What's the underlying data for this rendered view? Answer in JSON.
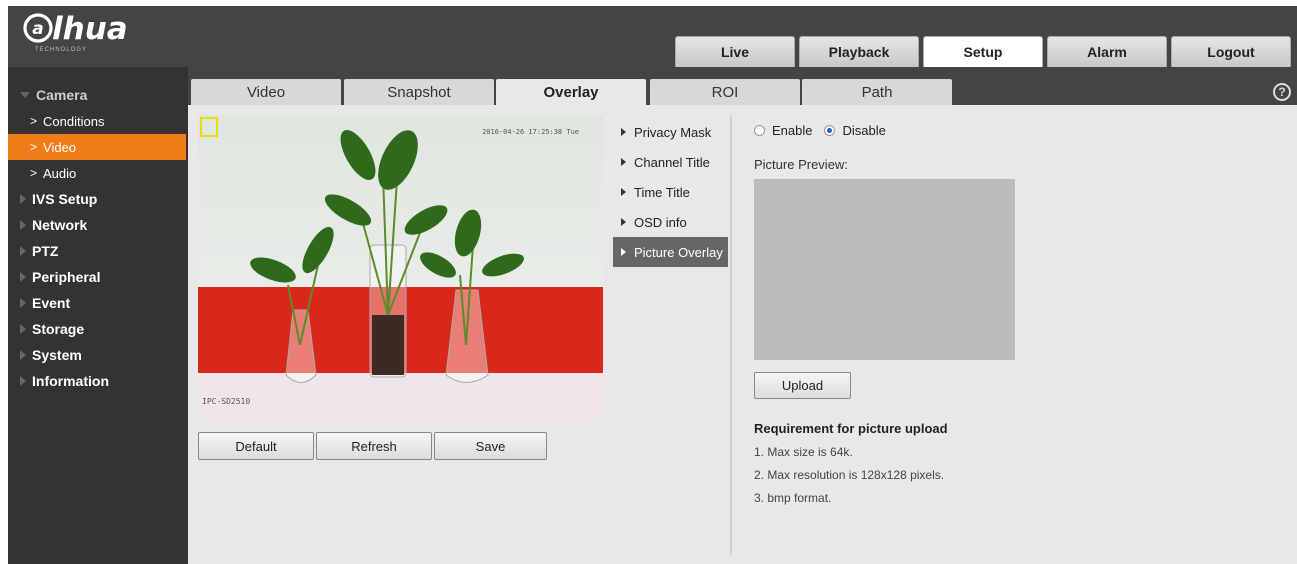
{
  "brand": {
    "logo": "alhua",
    "logo_sub": "TECHNOLOGY"
  },
  "main_tabs": [
    {
      "label": "Live",
      "active": false
    },
    {
      "label": "Playback",
      "active": false
    },
    {
      "label": "Setup",
      "active": true
    },
    {
      "label": "Alarm",
      "active": false
    },
    {
      "label": "Logout",
      "active": false
    }
  ],
  "sidebar": {
    "camera": "Camera",
    "camera_items": [
      {
        "label": "Conditions",
        "active": false
      },
      {
        "label": "Video",
        "active": true
      },
      {
        "label": "Audio",
        "active": false
      }
    ],
    "sections": [
      "IVS Setup",
      "Network",
      "PTZ",
      "Peripheral",
      "Event",
      "Storage",
      "System",
      "Information"
    ]
  },
  "sub_tabs": [
    {
      "label": "Video",
      "active": false
    },
    {
      "label": "Snapshot",
      "active": false
    },
    {
      "label": "Overlay",
      "active": true
    },
    {
      "label": "ROI",
      "active": false
    },
    {
      "label": "Path",
      "active": false
    }
  ],
  "help_icon": "?",
  "preview": {
    "osd_time": "2016-04-26 17:25:38 Tue",
    "osd_channel": "IPC-SD2510"
  },
  "buttons": {
    "default": "Default",
    "refresh": "Refresh",
    "save": "Save",
    "upload": "Upload"
  },
  "overlay_menu": [
    {
      "label": "Privacy Mask",
      "active": false
    },
    {
      "label": "Channel Title",
      "active": false
    },
    {
      "label": "Time Title",
      "active": false
    },
    {
      "label": "OSD info",
      "active": false
    },
    {
      "label": "Picture Overlay",
      "active": true
    }
  ],
  "picture_overlay": {
    "enable_label": "Enable",
    "disable_label": "Disable",
    "selected": "Disable",
    "preview_label": "Picture Preview:",
    "req_title": "Requirement for picture upload",
    "requirements": [
      "1. Max size is 64k.",
      "2. Max resolution is 128x128 pixels.",
      "3. bmp format."
    ]
  },
  "colors": {
    "accent": "#f07d1a",
    "header": "#444444",
    "sidebar": "#333333"
  }
}
